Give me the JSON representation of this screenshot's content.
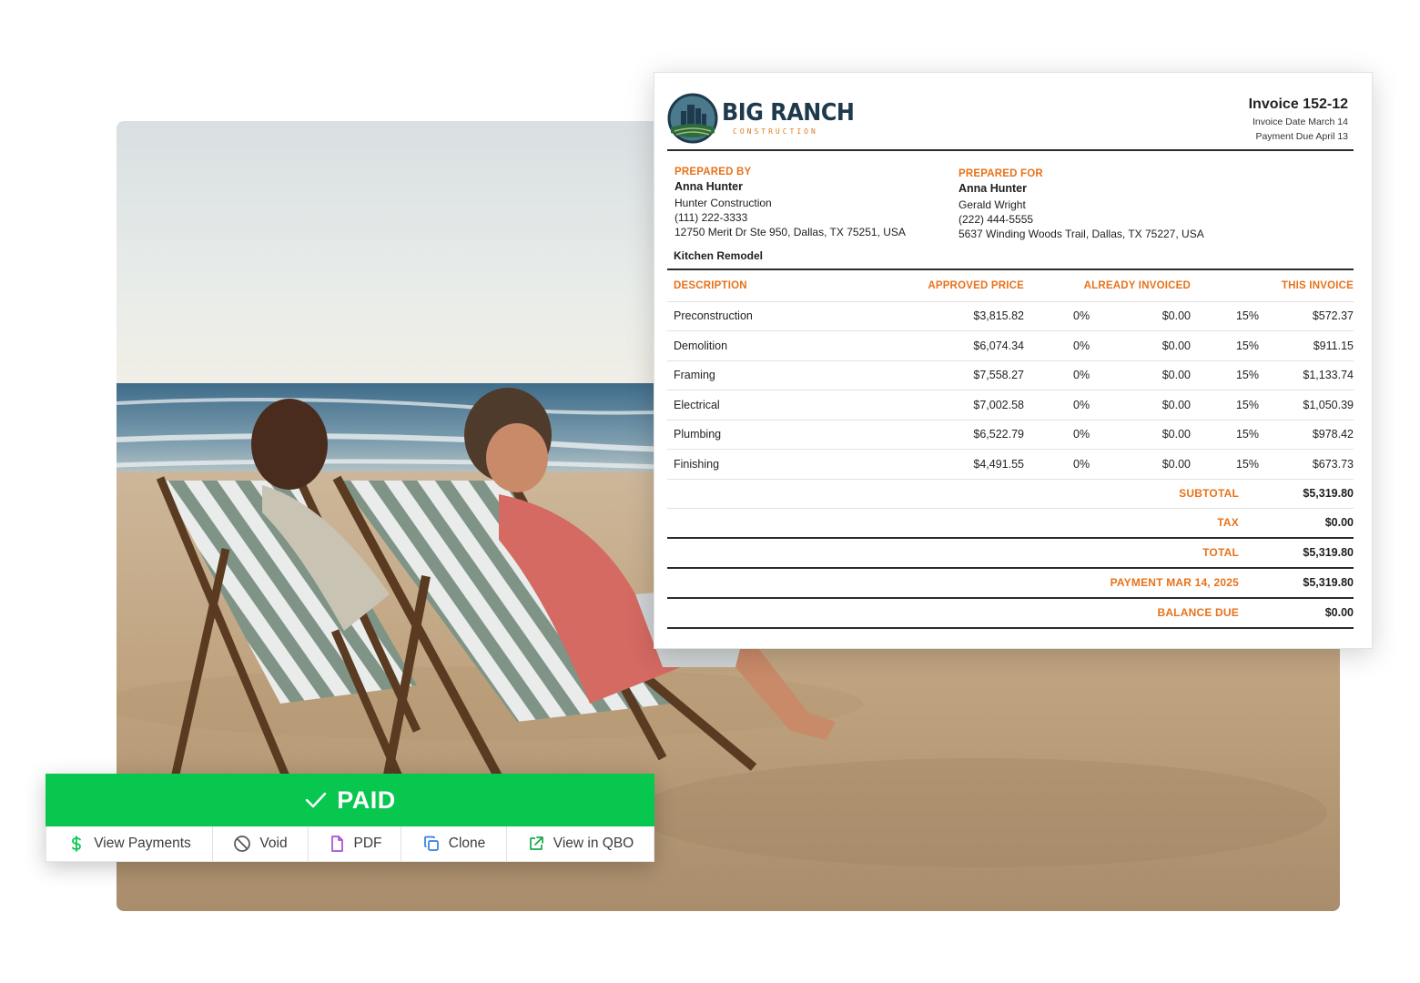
{
  "invoice": {
    "company_name": "BIG RANCH",
    "company_tagline": "CONSTRUCTION",
    "title": "Invoice 152-12",
    "invoice_date": "Invoice Date March 14",
    "payment_due": "Payment Due April 13",
    "prepared_by": {
      "label": "PREPARED BY",
      "name": "Anna Hunter",
      "company": "Hunter Construction",
      "phone": "(111) 222-3333",
      "address": "12750 Merit Dr Ste 950, Dallas, TX 75251, USA"
    },
    "prepared_for": {
      "label": "PREPARED FOR",
      "name": "Anna Hunter",
      "contact": "Gerald Wright",
      "phone": "(222) 444-5555",
      "address": "5637 Winding Woods Trail, Dallas, TX 75227, USA"
    },
    "project": "Kitchen Remodel",
    "columns": {
      "description": "DESCRIPTION",
      "approved_price": "APPROVED PRICE",
      "already_invoiced": "ALREADY INVOICED",
      "this_invoice": "THIS INVOICE"
    },
    "lines": [
      {
        "description": "Preconstruction",
        "approved": "$3,815.82",
        "inv_pct": "0%",
        "inv_amt": "$0.00",
        "this_pct": "15%",
        "this_amt": "$572.37"
      },
      {
        "description": "Demolition",
        "approved": "$6,074.34",
        "inv_pct": "0%",
        "inv_amt": "$0.00",
        "this_pct": "15%",
        "this_amt": "$911.15"
      },
      {
        "description": "Framing",
        "approved": "$7,558.27",
        "inv_pct": "0%",
        "inv_amt": "$0.00",
        "this_pct": "15%",
        "this_amt": "$1,133.74"
      },
      {
        "description": "Electrical",
        "approved": "$7,002.58",
        "inv_pct": "0%",
        "inv_amt": "$0.00",
        "this_pct": "15%",
        "this_amt": "$1,050.39"
      },
      {
        "description": "Plumbing",
        "approved": "$6,522.79",
        "inv_pct": "0%",
        "inv_amt": "$0.00",
        "this_pct": "15%",
        "this_amt": "$978.42"
      },
      {
        "description": "Finishing",
        "approved": "$4,491.55",
        "inv_pct": "0%",
        "inv_amt": "$0.00",
        "this_pct": "15%",
        "this_amt": "$673.73"
      }
    ],
    "totals": {
      "subtotal_label": "SUBTOTAL",
      "subtotal": "$5,319.80",
      "tax_label": "TAX",
      "tax": "$0.00",
      "total_label": "TOTAL",
      "total": "$5,319.80",
      "payment_label": "PAYMENT MAR 14, 2025",
      "payment": "$5,319.80",
      "balance_label": "BALANCE DUE",
      "balance": "$0.00"
    }
  },
  "status": {
    "label": "PAID",
    "color": "#07c74f"
  },
  "actions": [
    {
      "label": "View Payments",
      "icon": "dollar-icon",
      "color": "#07c74f"
    },
    {
      "label": "Void",
      "icon": "void-icon",
      "color": "#555555"
    },
    {
      "label": "PDF",
      "icon": "pdf-file-icon",
      "color": "#a64fd6"
    },
    {
      "label": "Clone",
      "icon": "clone-icon",
      "color": "#2f7fe0"
    },
    {
      "label": "View in QBO",
      "icon": "external-link-icon",
      "color": "#14a94a"
    }
  ],
  "colors": {
    "accent_orange": "#e8721b",
    "logo_navy": "#1f3a4d"
  }
}
